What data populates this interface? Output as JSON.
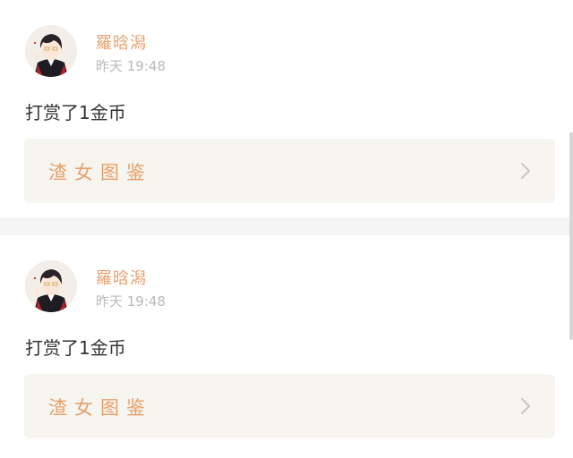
{
  "feed": [
    {
      "username": "羅晗潟",
      "timestamp": "昨天 19:48",
      "message": "打赏了1金币",
      "link": {
        "title": "渣女图鉴",
        "icon": "chevron-right-icon"
      },
      "avatar": "avatar-anime-character"
    },
    {
      "username": "羅晗潟",
      "timestamp": "昨天 19:48",
      "message": "打赏了1金币",
      "link": {
        "title": "渣女图鉴",
        "icon": "chevron-right-icon"
      },
      "avatar": "avatar-anime-character"
    }
  ],
  "colors": {
    "username": "#e9a16f",
    "link_title": "#e7a06b",
    "timestamp": "#b9b9b9",
    "link_bg": "#f6f5ef",
    "separator": "#f5f5f5"
  }
}
